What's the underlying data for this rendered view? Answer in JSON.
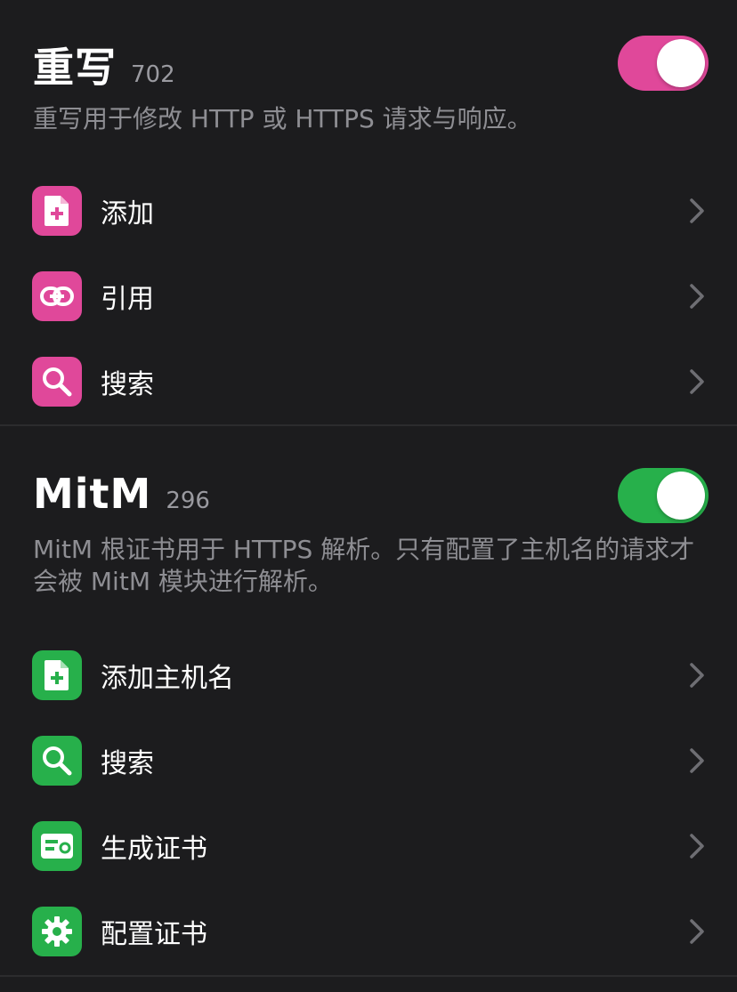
{
  "colors": {
    "background": "#1c1c1e",
    "rewrite_accent": "#e0489a",
    "mitm_accent": "#27b04b",
    "secondary_text": "#8e8e93"
  },
  "rewrite": {
    "title": "重写",
    "count": "702",
    "toggle_on": true,
    "description": "重写用于修改 HTTP 或 HTTPS 请求与响应。",
    "items": [
      {
        "label": "添加",
        "icon": "add-document-icon"
      },
      {
        "label": "引用",
        "icon": "link-icon"
      },
      {
        "label": "搜索",
        "icon": "search-icon"
      }
    ]
  },
  "mitm": {
    "title": "MitM",
    "count": "296",
    "toggle_on": true,
    "description": "MitM 根证书用于 HTTPS 解析。只有配置了主机名的请求才会被 MitM 模块进行解析。",
    "items": [
      {
        "label": "添加主机名",
        "icon": "add-document-icon"
      },
      {
        "label": "搜索",
        "icon": "search-icon"
      },
      {
        "label": "生成证书",
        "icon": "certificate-icon"
      },
      {
        "label": "配置证书",
        "icon": "gear-icon"
      }
    ]
  }
}
